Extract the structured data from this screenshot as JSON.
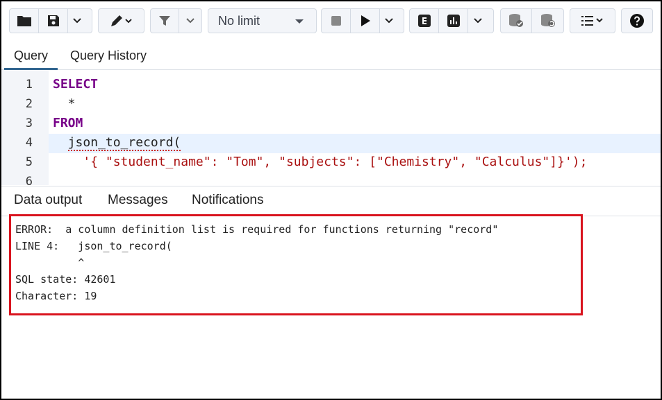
{
  "toolbar": {
    "limit_value": "No limit",
    "icons": [
      "folder-icon",
      "save-icon",
      "chevron-down-icon",
      "edit-pen-icon",
      "chevron-down-icon",
      "filter-icon",
      "chevron-down-icon",
      "stop-icon",
      "play-icon",
      "chevron-down-icon",
      "explain-icon",
      "explain-analyze-icon",
      "chevron-down-icon",
      "commit-icon",
      "rollback-icon",
      "macros-icon",
      "help-icon"
    ]
  },
  "query_tabs": [
    {
      "label": "Query"
    },
    {
      "label": "Query History"
    }
  ],
  "editor": {
    "line_numbers": [
      "1",
      "2",
      "3",
      "4",
      "5",
      "6"
    ],
    "lines": {
      "l1": "SELECT",
      "l2": "  *",
      "l3": "FROM",
      "l4": "  json_to_record(",
      "l5": "    '{ \"student_name\": \"Tom\", \"subjects\": [\"Chemistry\", \"Calculus\"]}');"
    }
  },
  "result_tabs": [
    {
      "label": "Data output"
    },
    {
      "label": "Messages"
    },
    {
      "label": "Notifications"
    }
  ],
  "messages": [
    "ERROR:  a column definition list is required for functions returning \"record\"",
    "LINE 4:   json_to_record(",
    "          ^",
    "SQL state: 42601",
    "Character: 19"
  ],
  "colors": {
    "accent": "#326690",
    "error_border": "#d9141e",
    "keyword": "#770088",
    "string": "#aa1111"
  }
}
